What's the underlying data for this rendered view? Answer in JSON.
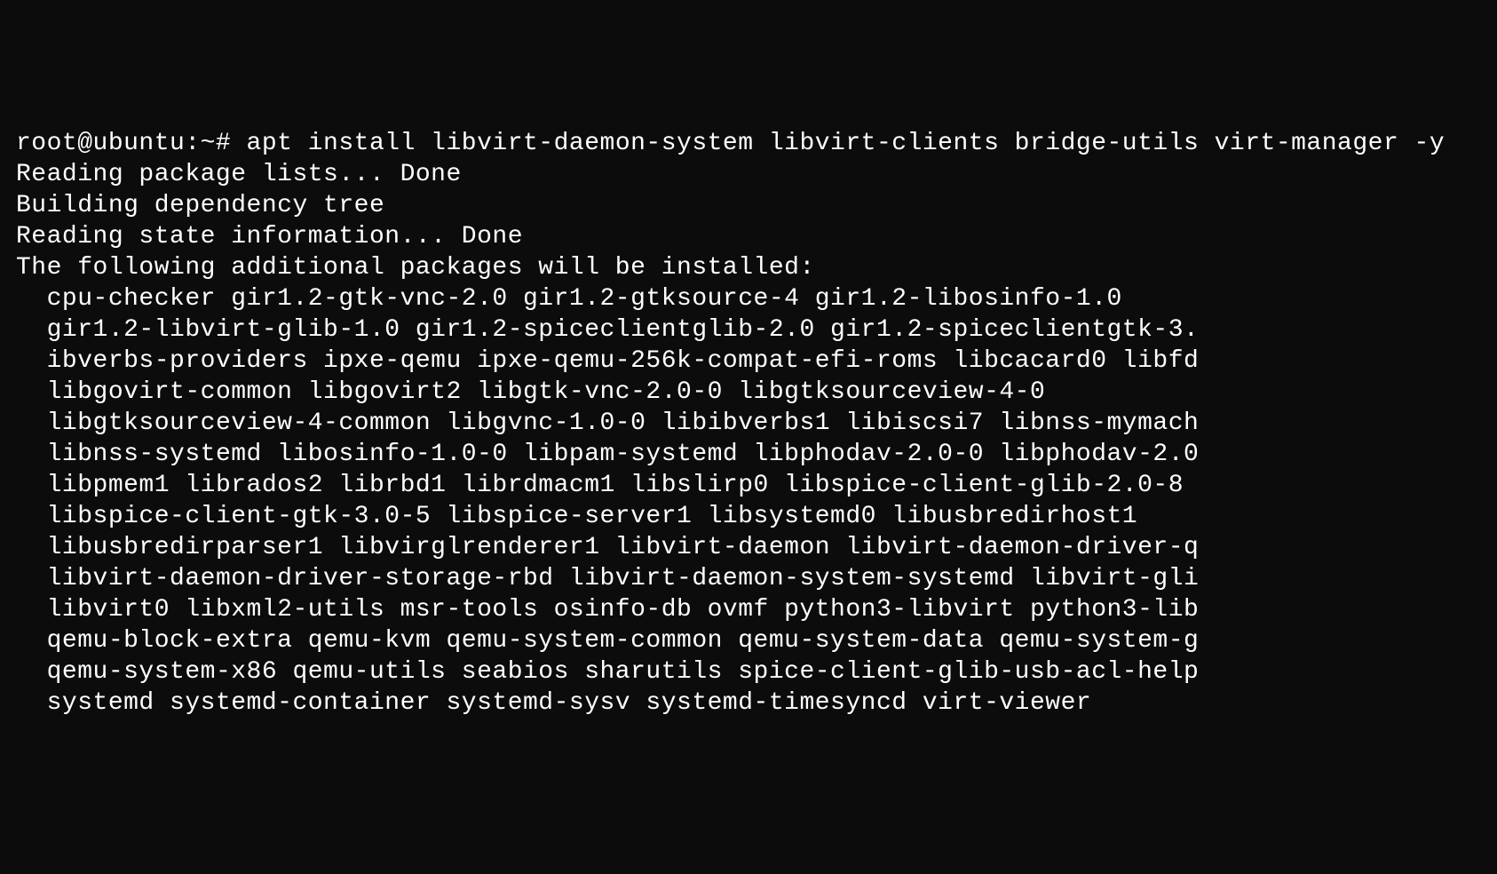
{
  "terminal": {
    "prompt": "root@ubuntu:~# ",
    "command": "apt install libvirt-daemon-system libvirt-clients bridge-utils virt-manager -y",
    "output_lines": [
      "Reading package lists... Done",
      "Building dependency tree",
      "Reading state information... Done",
      "The following additional packages will be installed:",
      "  cpu-checker gir1.2-gtk-vnc-2.0 gir1.2-gtksource-4 gir1.2-libosinfo-1.0",
      "  gir1.2-libvirt-glib-1.0 gir1.2-spiceclientglib-2.0 gir1.2-spiceclientgtk-3.",
      "  ibverbs-providers ipxe-qemu ipxe-qemu-256k-compat-efi-roms libcacard0 libfd",
      "  libgovirt-common libgovirt2 libgtk-vnc-2.0-0 libgtksourceview-4-0",
      "  libgtksourceview-4-common libgvnc-1.0-0 libibverbs1 libiscsi7 libnss-mymach",
      "  libnss-systemd libosinfo-1.0-0 libpam-systemd libphodav-2.0-0 libphodav-2.0",
      "  libpmem1 librados2 librbd1 librdmacm1 libslirp0 libspice-client-glib-2.0-8",
      "  libspice-client-gtk-3.0-5 libspice-server1 libsystemd0 libusbredirhost1",
      "  libusbredirparser1 libvirglrenderer1 libvirt-daemon libvirt-daemon-driver-q",
      "  libvirt-daemon-driver-storage-rbd libvirt-daemon-system-systemd libvirt-gli",
      "  libvirt0 libxml2-utils msr-tools osinfo-db ovmf python3-libvirt python3-lib",
      "  qemu-block-extra qemu-kvm qemu-system-common qemu-system-data qemu-system-g",
      "  qemu-system-x86 qemu-utils seabios sharutils spice-client-glib-usb-acl-help",
      "  systemd systemd-container systemd-sysv systemd-timesyncd virt-viewer"
    ]
  }
}
